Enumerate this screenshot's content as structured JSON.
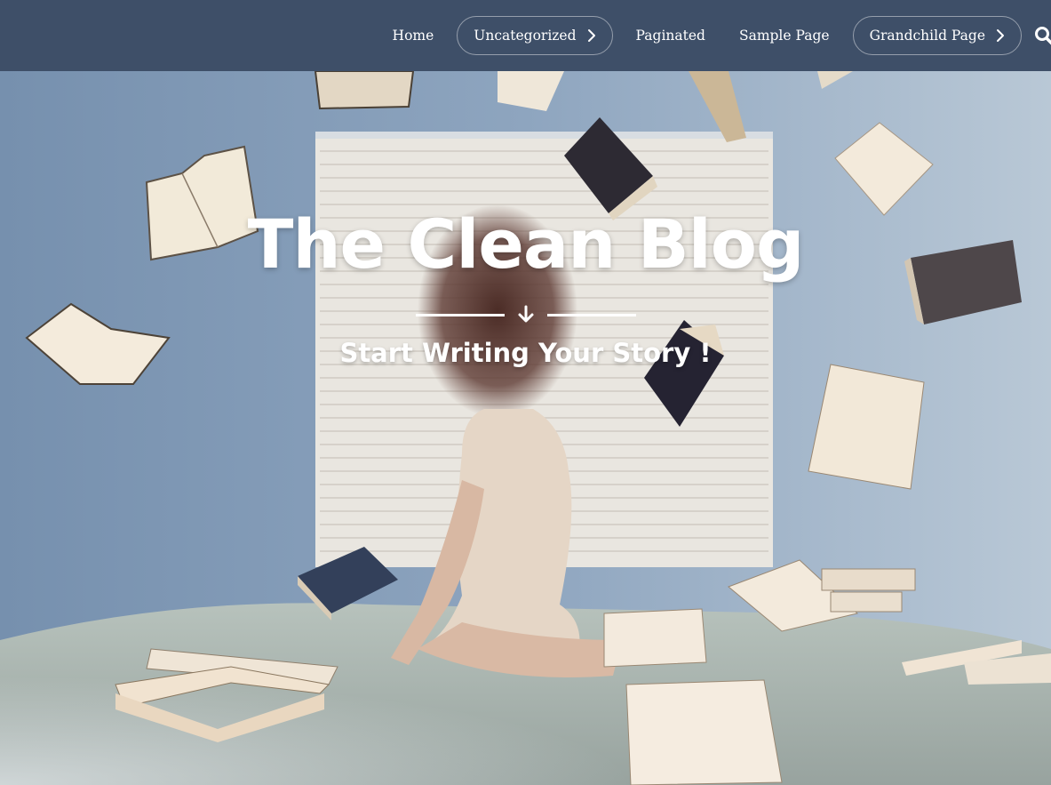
{
  "nav": {
    "items": [
      {
        "label": "Home",
        "has_children": false
      },
      {
        "label": "Uncategorized",
        "has_children": true
      },
      {
        "label": "Paginated",
        "has_children": false
      },
      {
        "label": "Sample Page",
        "has_children": false
      },
      {
        "label": "Grandchild Page",
        "has_children": true
      }
    ],
    "search_icon": "search-icon"
  },
  "hero": {
    "title": "The Clean Blog",
    "subtitle": "Start Writing Your Story !",
    "divider_icon": "arrow-down-icon",
    "background_description_icon": "hero-image"
  },
  "colors": {
    "navbar": "#3e4f68",
    "text": "#ffffff"
  }
}
